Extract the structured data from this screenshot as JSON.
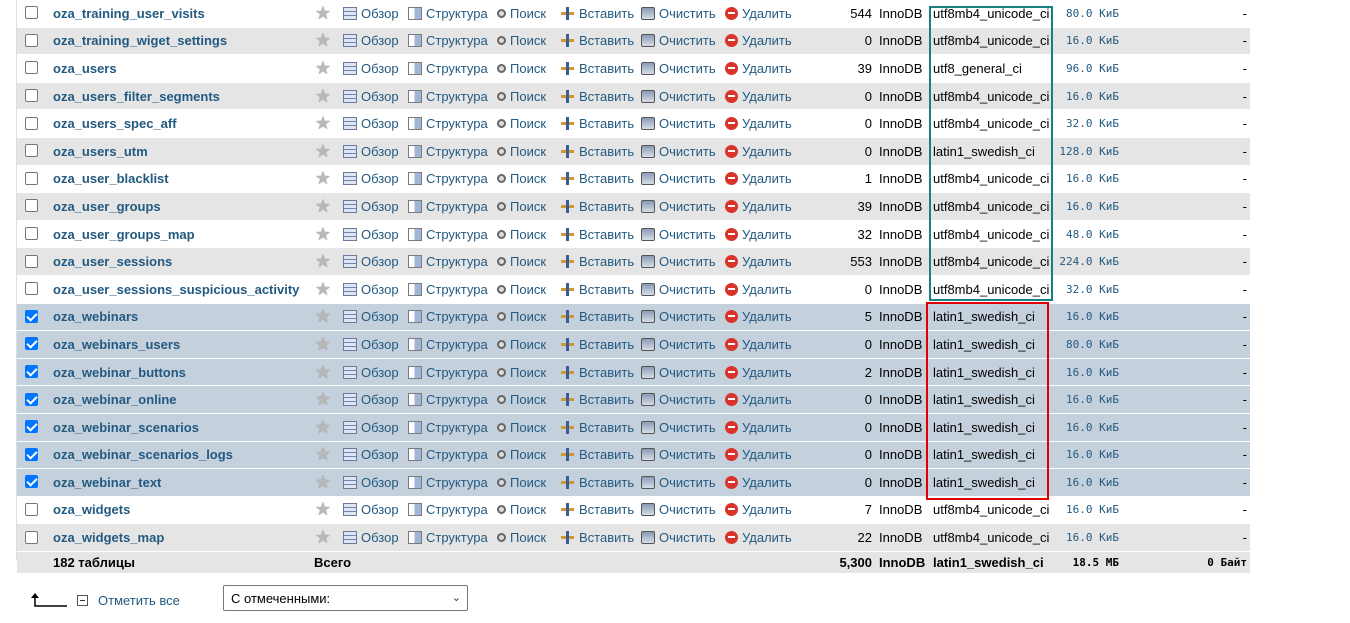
{
  "actions": {
    "browse": "Обзор",
    "structure": "Структура",
    "search": "Поиск",
    "insert": "Вставить",
    "empty": "Очистить",
    "drop": "Удалить"
  },
  "star_glyph": "★",
  "rows": [
    {
      "name": "oza_training_user_visits",
      "rows": "544",
      "engine": "InnoDB",
      "collation": "utf8mb4_unicode_ci",
      "size": "80.0 КиБ",
      "overhead": "-",
      "checked": false
    },
    {
      "name": "oza_training_wiget_settings",
      "rows": "0",
      "engine": "InnoDB",
      "collation": "utf8mb4_unicode_ci",
      "size": "16.0 КиБ",
      "overhead": "-",
      "checked": false
    },
    {
      "name": "oza_users",
      "rows": "39",
      "engine": "InnoDB",
      "collation": "utf8_general_ci",
      "size": "96.0 КиБ",
      "overhead": "-",
      "checked": false
    },
    {
      "name": "oza_users_filter_segments",
      "rows": "0",
      "engine": "InnoDB",
      "collation": "utf8mb4_unicode_ci",
      "size": "16.0 КиБ",
      "overhead": "-",
      "checked": false
    },
    {
      "name": "oza_users_spec_aff",
      "rows": "0",
      "engine": "InnoDB",
      "collation": "utf8mb4_unicode_ci",
      "size": "32.0 КиБ",
      "overhead": "-",
      "checked": false
    },
    {
      "name": "oza_users_utm",
      "rows": "0",
      "engine": "InnoDB",
      "collation": "latin1_swedish_ci",
      "size": "128.0 КиБ",
      "overhead": "-",
      "checked": false
    },
    {
      "name": "oza_user_blacklist",
      "rows": "1",
      "engine": "InnoDB",
      "collation": "utf8mb4_unicode_ci",
      "size": "16.0 КиБ",
      "overhead": "-",
      "checked": false
    },
    {
      "name": "oza_user_groups",
      "rows": "39",
      "engine": "InnoDB",
      "collation": "utf8mb4_unicode_ci",
      "size": "16.0 КиБ",
      "overhead": "-",
      "checked": false
    },
    {
      "name": "oza_user_groups_map",
      "rows": "32",
      "engine": "InnoDB",
      "collation": "utf8mb4_unicode_ci",
      "size": "48.0 КиБ",
      "overhead": "-",
      "checked": false
    },
    {
      "name": "oza_user_sessions",
      "rows": "553",
      "engine": "InnoDB",
      "collation": "utf8mb4_unicode_ci",
      "size": "224.0 КиБ",
      "overhead": "-",
      "checked": false
    },
    {
      "name": "oza_user_sessions_suspicious_activity",
      "rows": "0",
      "engine": "InnoDB",
      "collation": "utf8mb4_unicode_ci",
      "size": "32.0 КиБ",
      "overhead": "-",
      "checked": false
    },
    {
      "name": "oza_webinars",
      "rows": "5",
      "engine": "InnoDB",
      "collation": "latin1_swedish_ci",
      "size": "16.0 КиБ",
      "overhead": "-",
      "checked": true
    },
    {
      "name": "oza_webinars_users",
      "rows": "0",
      "engine": "InnoDB",
      "collation": "latin1_swedish_ci",
      "size": "80.0 КиБ",
      "overhead": "-",
      "checked": true
    },
    {
      "name": "oza_webinar_buttons",
      "rows": "2",
      "engine": "InnoDB",
      "collation": "latin1_swedish_ci",
      "size": "16.0 КиБ",
      "overhead": "-",
      "checked": true
    },
    {
      "name": "oza_webinar_online",
      "rows": "0",
      "engine": "InnoDB",
      "collation": "latin1_swedish_ci",
      "size": "16.0 КиБ",
      "overhead": "-",
      "checked": true
    },
    {
      "name": "oza_webinar_scenarios",
      "rows": "0",
      "engine": "InnoDB",
      "collation": "latin1_swedish_ci",
      "size": "16.0 КиБ",
      "overhead": "-",
      "checked": true
    },
    {
      "name": "oza_webinar_scenarios_logs",
      "rows": "0",
      "engine": "InnoDB",
      "collation": "latin1_swedish_ci",
      "size": "16.0 КиБ",
      "overhead": "-",
      "checked": true
    },
    {
      "name": "oza_webinar_text",
      "rows": "0",
      "engine": "InnoDB",
      "collation": "latin1_swedish_ci",
      "size": "16.0 КиБ",
      "overhead": "-",
      "checked": true
    },
    {
      "name": "oza_widgets",
      "rows": "7",
      "engine": "InnoDB",
      "collation": "utf8mb4_unicode_ci",
      "size": "16.0 КиБ",
      "overhead": "-",
      "checked": false
    },
    {
      "name": "oza_widgets_map",
      "rows": "22",
      "engine": "InnoDB",
      "collation": "utf8mb4_unicode_ci",
      "size": "16.0 КиБ",
      "overhead": "-",
      "checked": false
    }
  ],
  "total": {
    "tables": "182 таблицы",
    "label": "Всего",
    "rows": "5,300",
    "engine": "InnoDB",
    "collation": "latin1_swedish_ci",
    "size": "18.5 МБ",
    "overhead": "0 Байт"
  },
  "footer": {
    "check_all": "Отметить все",
    "with_selected": "С отмеченными:",
    "chevron": "⌄"
  },
  "colors": {
    "teal_box": "#1a7f7f",
    "red_box": "#e00000",
    "selected_row": "#c5d0dd",
    "link": "#235a81"
  }
}
